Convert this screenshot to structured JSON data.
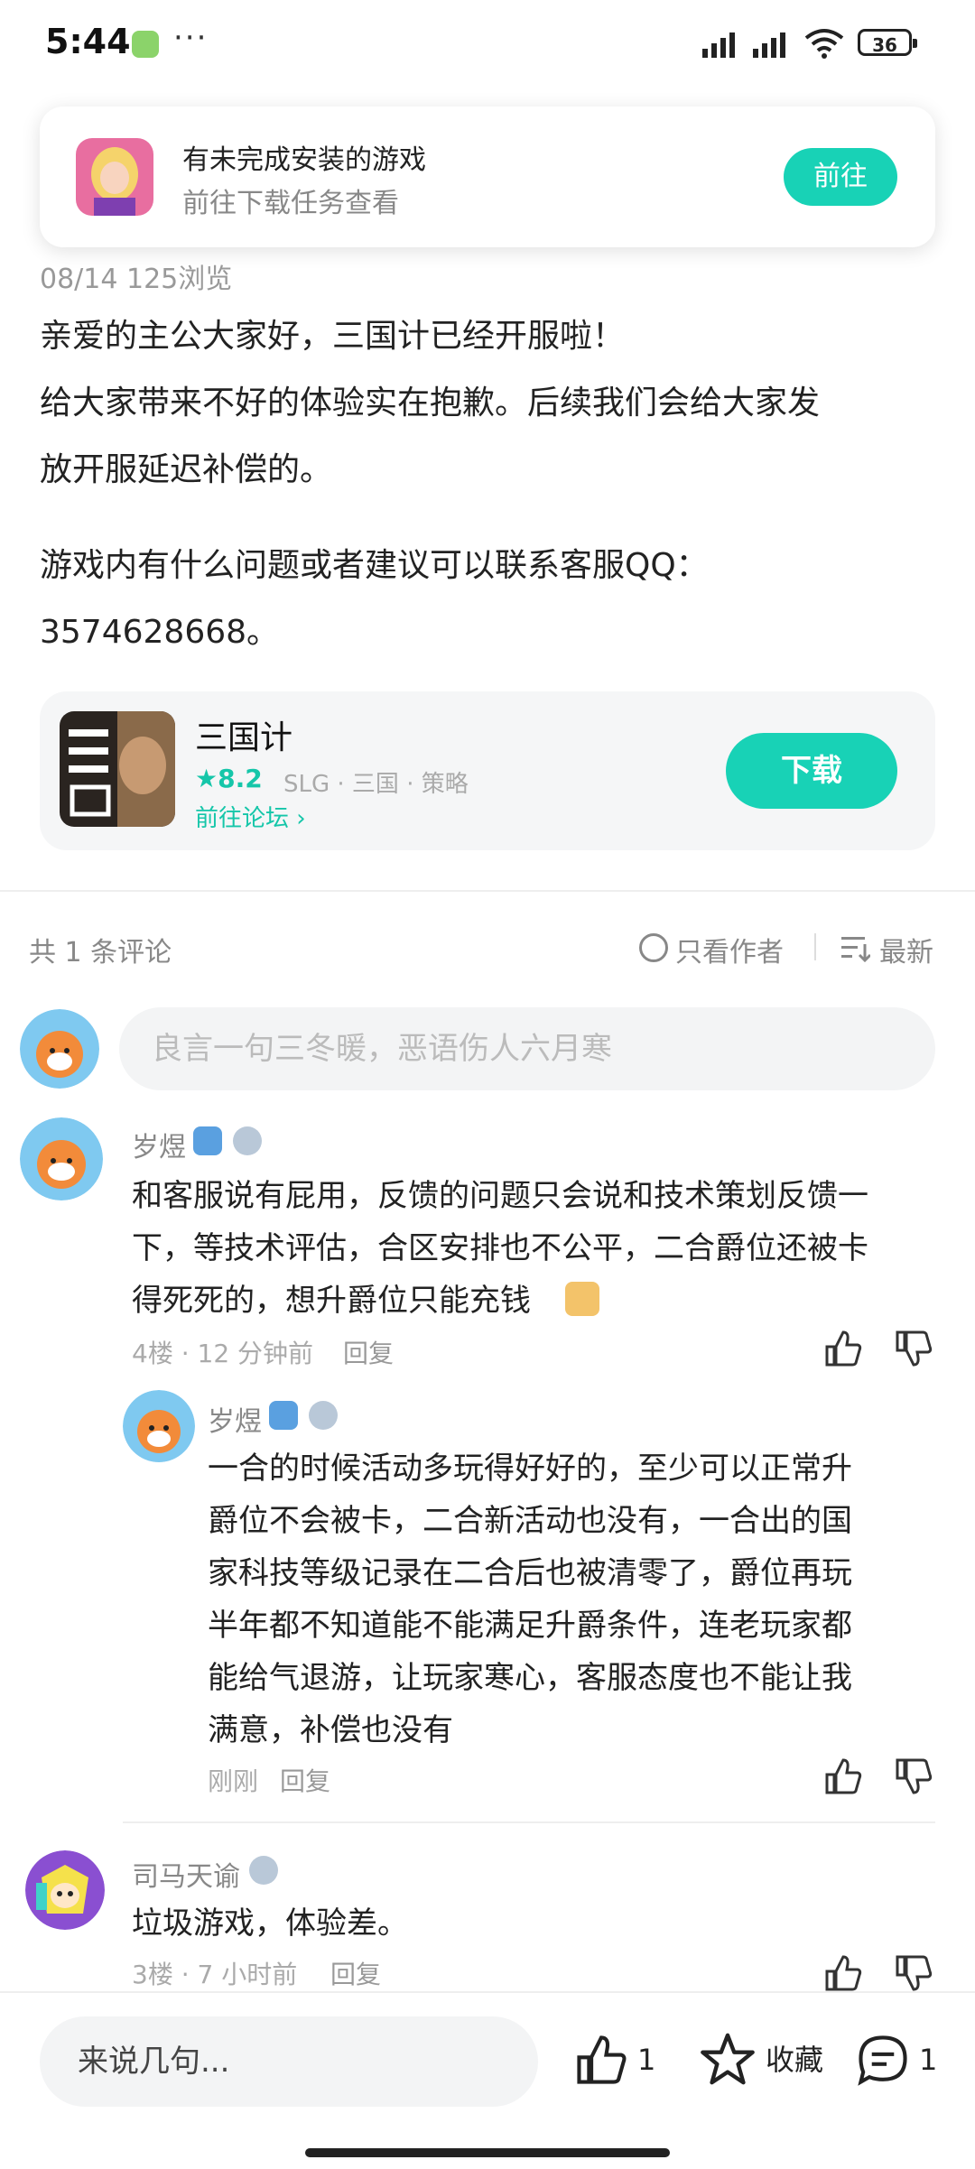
{
  "status_bar": {
    "time": "5:44",
    "more": "···",
    "battery": "36"
  },
  "notification": {
    "title": "有未完成安装的游戏",
    "subtitle": "前往下载任务查看",
    "button": "前往"
  },
  "post": {
    "meta": "08/14  125浏览",
    "lines": [
      "亲爱的主公大家好，三国计已经开服啦！",
      "给大家带来不好的体验实在抱歉。后续我们会给大家发",
      "放开服延迟补偿的。",
      "游戏内有什么问题或者建议可以联系客服QQ：",
      "3574628668。"
    ]
  },
  "game": {
    "name": "三国计",
    "rating": "8.2",
    "tags": "SLG · 三国 · 策略",
    "forum_link": "前往论坛 ›",
    "download": "下载"
  },
  "comments_header": {
    "count": "共 1 条评论",
    "author_only": "只看作者",
    "sort": "最新"
  },
  "comment_input": {
    "placeholder": "良言一句三冬暖，恶语伤人六月寒"
  },
  "comments": [
    {
      "user": "岁煜",
      "lines": [
        "和客服说有屁用，反馈的问题只会说和技术策划反馈一",
        "下，等技术评估，合区安排也不公平，二合爵位还被卡",
        "得死死的，想升爵位只能充钱"
      ],
      "meta": "4楼 · 12 分钟前",
      "reply": "回复"
    },
    {
      "user": "岁煜",
      "lines": [
        "一合的时候活动多玩得好好的，至少可以正常升",
        "爵位不会被卡，二合新活动也没有，一合出的国",
        "家科技等级记录在二合后也被清零了，爵位再玩",
        "半年都不知道能不能满足升爵条件，连老玩家都",
        "能给气退游，让玩家寒心，客服态度也不能让我",
        "满意，补偿也没有"
      ],
      "meta": "刚刚",
      "reply": "回复"
    },
    {
      "user": "司马天谕",
      "lines": [
        "垃圾游戏，体验差。"
      ],
      "meta": "3楼 · 7 小时前",
      "reply": "回复"
    }
  ],
  "bottom_bar": {
    "say_placeholder": "来说几句...",
    "like_count": "1",
    "favorite": "收藏",
    "comment_count": "1"
  },
  "colors": {
    "accent": "#18d2b6"
  }
}
